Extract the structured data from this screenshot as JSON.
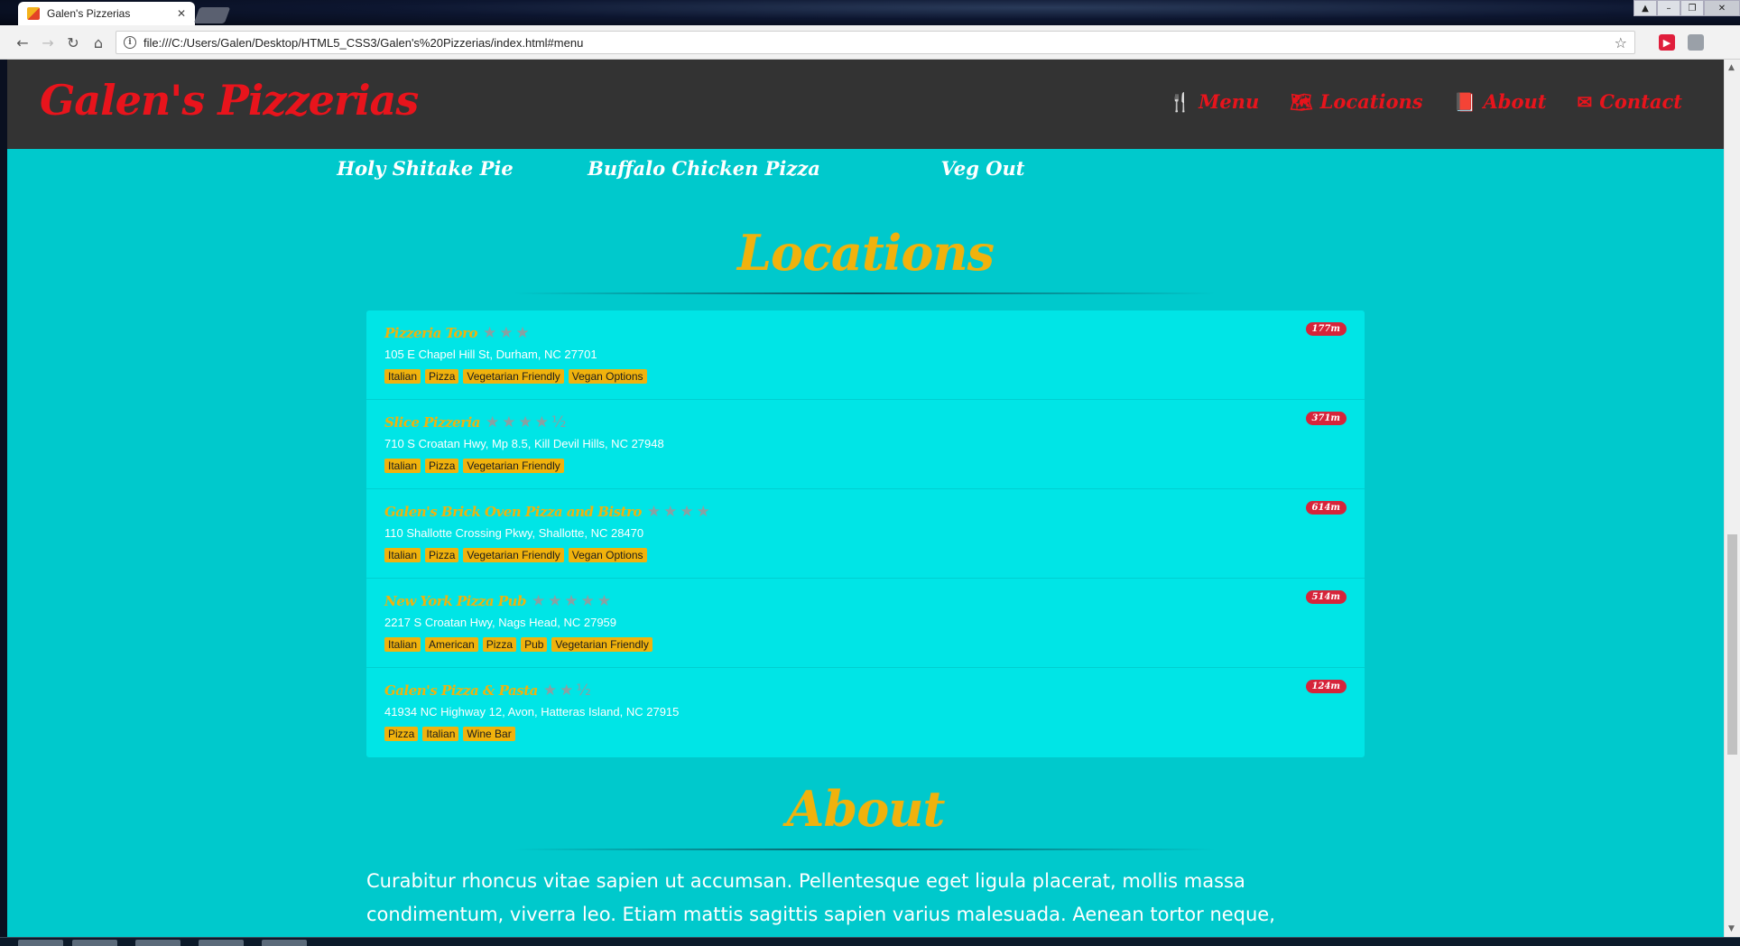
{
  "browser": {
    "tab_title": "Galen's Pizzerias",
    "tab_close": "✕",
    "url": "file:///C:/Users/Galen/Desktop/HTML5_CSS3/Galen's%20Pizzerias/index.html#menu",
    "ext_label": "▶"
  },
  "site": {
    "brand": "Galen's Pizzerias",
    "nav": [
      {
        "label": "Menu",
        "icon": "fork-knife-icon",
        "glyph": "🍴"
      },
      {
        "label": "Locations",
        "icon": "map-icon",
        "glyph": "🗺"
      },
      {
        "label": "About",
        "icon": "book-icon",
        "glyph": "📕"
      },
      {
        "label": "Contact",
        "icon": "envelope-icon",
        "glyph": "✉"
      }
    ],
    "menu_items": [
      "Holy Shitake Pie",
      "Buffalo Chicken Pizza",
      "Veg Out"
    ]
  },
  "locations": {
    "title": "Locations",
    "items": [
      {
        "name": "Pizzeria Toro",
        "stars": "★★★",
        "distance": "177m",
        "address": "105 E Chapel Hill St, Durham, NC 27701",
        "tags": [
          "Italian",
          "Pizza",
          "Vegetarian Friendly",
          "Vegan Options"
        ]
      },
      {
        "name": "Slice Pizzeria",
        "stars": "★★★★½",
        "distance": "371m",
        "address": "710 S Croatan Hwy, Mp 8.5, Kill Devil Hills, NC 27948",
        "tags": [
          "Italian",
          "Pizza",
          "Vegetarian Friendly"
        ]
      },
      {
        "name": "Galen's Brick Oven Pizza and Bistro",
        "stars": "★★★★",
        "distance": "614m",
        "address": "110 Shallotte Crossing Pkwy, Shallotte, NC 28470",
        "tags": [
          "Italian",
          "Pizza",
          "Vegetarian Friendly",
          "Vegan Options"
        ]
      },
      {
        "name": "New York Pizza Pub",
        "stars": "★★★★★",
        "distance": "514m",
        "address": "2217 S Croatan Hwy, Nags Head, NC 27959",
        "tags": [
          "Italian",
          "American",
          "Pizza",
          "Pub",
          "Vegetarian Friendly"
        ]
      },
      {
        "name": "Galen's Pizza & Pasta",
        "stars": "★★½",
        "distance": "124m",
        "address": "41934 NC Highway 12, Avon, Hatteras Island, NC 27915",
        "tags": [
          "Pizza",
          "Italian",
          "Wine Bar"
        ]
      }
    ]
  },
  "about": {
    "title": "About",
    "text": "Curabitur rhoncus vitae sapien ut accumsan. Pellentesque eget ligula placerat, mollis massa condimentum, viverra leo. Etiam mattis sagittis sapien varius malesuada. Aenean tortor neque,"
  },
  "colors": {
    "accent_red": "#e8141c",
    "gold": "#f0b20d",
    "teal": "#00c9cc",
    "header": "#333333"
  }
}
